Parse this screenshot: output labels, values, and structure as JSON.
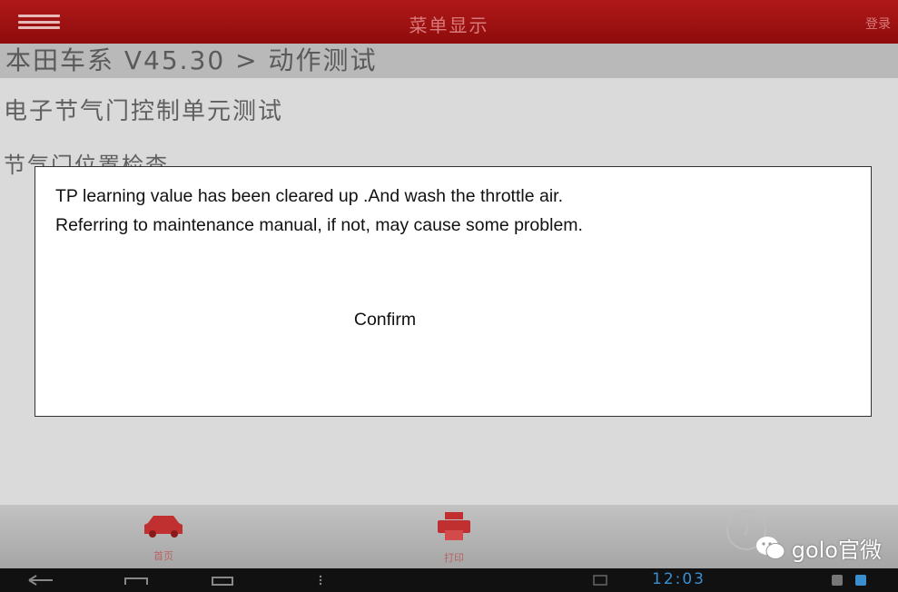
{
  "header": {
    "title": "菜单显示",
    "login_label": "登录"
  },
  "breadcrumb": "本田车系 V45.30 > 动作测试",
  "content": {
    "heading_test": "电子节气门控制单元测试",
    "heading_check": "节气门位置检查"
  },
  "dialog": {
    "message_line1": "TP learning value has been cleared up .And wash the throttle air.",
    "message_line2": "Referring to maintenance manual, if not, may cause some problem.",
    "confirm_label": "Confirm"
  },
  "bottom_bar": {
    "home_label": "首页",
    "print_label": "打印"
  },
  "watermark": "golo官微",
  "status": {
    "clock": "12:03"
  },
  "colors": {
    "titlebar": "#a31414",
    "dialog_bg": "#ffffff",
    "accent_icon": "#c03030",
    "clock": "#3a8fd0"
  }
}
